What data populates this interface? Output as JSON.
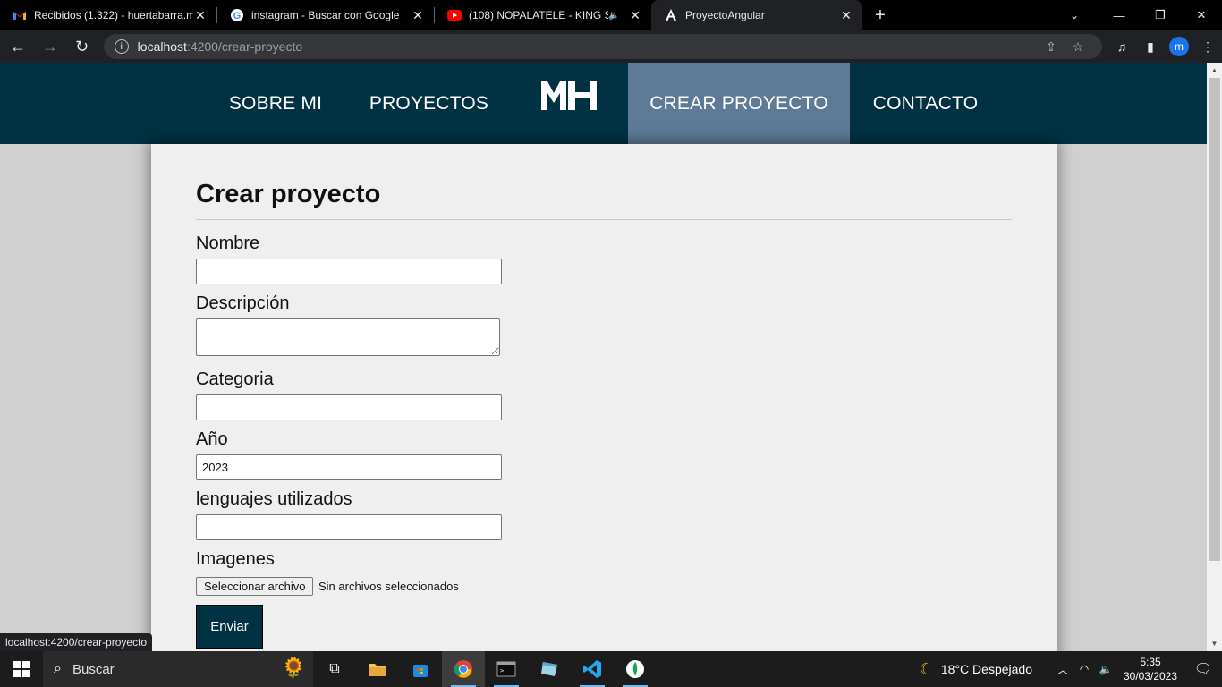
{
  "browser": {
    "tabs": [
      {
        "title": "Recibidos (1.322) - huertabarra.m",
        "favicon": "gmail-icon",
        "active": false
      },
      {
        "title": "instagram - Buscar con Google",
        "favicon": "google-icon",
        "active": false
      },
      {
        "title": "(108) NOPALATELE - KING SA",
        "favicon": "youtube-icon",
        "active": false,
        "audio": true
      },
      {
        "title": "ProyectoAngular",
        "favicon": "angular-icon",
        "active": true
      }
    ],
    "url_host": "localhost",
    "url_path": ":4200/crear-proyecto",
    "profile_initial": "m",
    "status_url": "localhost:4200/crear-proyecto"
  },
  "site": {
    "nav": {
      "sobre_mi": "SOBRE MI",
      "proyectos": "PROYECTOS",
      "crear_proyecto": "CREAR PROYECTO",
      "contacto": "CONTACTO",
      "logo_text": "MH"
    },
    "form": {
      "title": "Crear proyecto",
      "nombre_label": "Nombre",
      "nombre_value": "",
      "descripcion_label": "Descripción",
      "categoria_label": "Categoria",
      "categoria_value": "",
      "anio_label": "Año",
      "anio_value": "2023",
      "lenguajes_label": "lenguajes utilizados",
      "lenguajes_value": "",
      "imagenes_label": "Imagenes",
      "file_button": "Seleccionar archivo",
      "file_status": "Sin archivos seleccionados",
      "submit_label": "Enviar"
    }
  },
  "taskbar": {
    "search_placeholder": "Buscar",
    "weather": "18°C  Despejado",
    "time": "5:35",
    "date": "30/03/2023"
  },
  "colors": {
    "navbar": "#013243",
    "nav_active": "#5e7a96",
    "page_bg": "#d0d0d0",
    "card_bg": "#efefef"
  }
}
